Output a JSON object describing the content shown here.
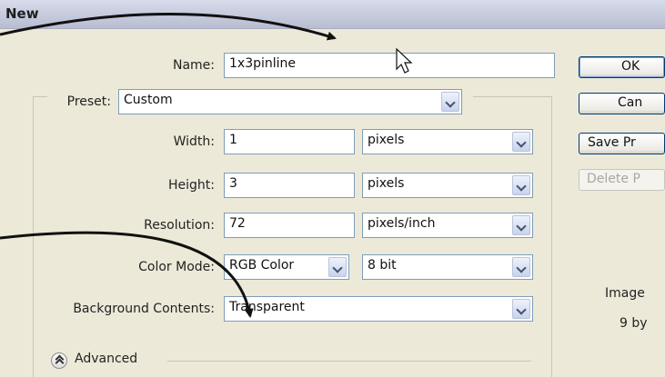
{
  "window": {
    "title": "New"
  },
  "form": {
    "name_label": "Name:",
    "name_value": "1x3pinline",
    "preset_label": "Preset:",
    "preset_value": "Custom",
    "width_label": "Width:",
    "width_value": "1",
    "width_unit": "pixels",
    "height_label": "Height:",
    "height_value": "3",
    "height_unit": "pixels",
    "resolution_label": "Resolution:",
    "resolution_value": "72",
    "resolution_unit": "pixels/inch",
    "color_mode_label": "Color Mode:",
    "color_mode_value": "RGB Color",
    "bit_depth_value": "8 bit",
    "background_label": "Background Contents:",
    "background_value": "Transparent",
    "advanced_label": "Advanced"
  },
  "buttons": {
    "ok": "OK",
    "cancel": "Can",
    "save_preset": "Save Pr",
    "delete_preset": "Delete P"
  },
  "info": {
    "image_size_label": "Image",
    "image_size_value": "9 by"
  },
  "icons": {
    "cursor": "mouse-pointer-icon",
    "advanced_toggle": "double-chevron-up-icon",
    "annotation": "curved-arrow-icon"
  },
  "colors": {
    "titlebar": "#c5cadc",
    "dialog_bg": "#ece9d8",
    "field_border": "#7f9db9",
    "button_border": "#003c74"
  }
}
